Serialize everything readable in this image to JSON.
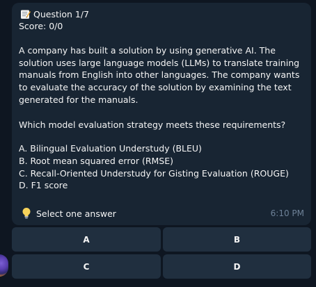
{
  "message": {
    "icons": {
      "header": "memo-icon",
      "hint": "light-bulb-icon"
    },
    "question_label": "Question 1/7",
    "score": "Score: 0/0",
    "paragraph": "A company has built a solution by using generative AI. The solution uses large language models (LLMs) to translate training manuals from English into other languages. The company wants to evaluate the accuracy of the solution by examining the text generated for the manuals.",
    "prompt": "Which model evaluation strategy meets these requirements?",
    "options": [
      "A. Bilingual Evaluation Understudy (BLEU)",
      "B. Root mean squared error (RMSE)",
      "C. Recall-Oriented Understudy for Gisting Evaluation (ROUGE)",
      "D. F1 score"
    ],
    "hint": "Select one answer",
    "time": "6:10 PM"
  },
  "keyboard": {
    "a": "A",
    "b": "B",
    "c": "C",
    "d": "D"
  },
  "colors": {
    "background": "#0e1621",
    "bubble": "#182533",
    "button": "#202f3f",
    "time": "#6d8197"
  }
}
